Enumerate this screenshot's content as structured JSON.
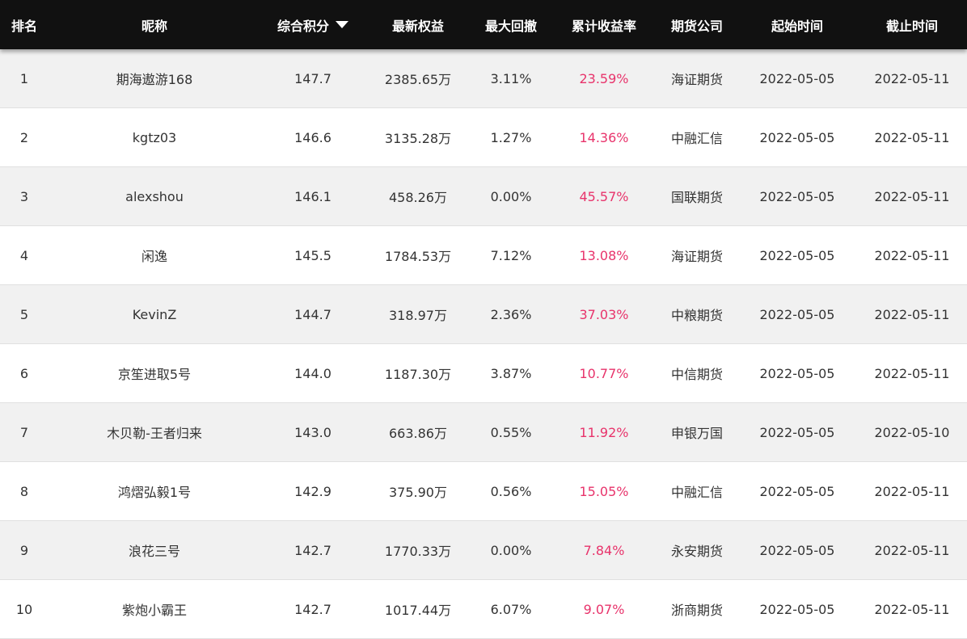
{
  "header": {
    "rank": "排名",
    "name": "昵称",
    "score": "综合积分",
    "equity": "最新权益",
    "drawdown": "最大回撤",
    "return": "累计收益率",
    "company": "期货公司",
    "start": "起始时间",
    "end": "截止时间",
    "sort_icon": "caret-down-icon"
  },
  "colors": {
    "header_bg": "#111111",
    "odd_row_bg": "#f1f1f1",
    "return_text": "#e8336b"
  },
  "rows": [
    {
      "rank": "1",
      "name": "期海遨游168",
      "score": "147.7",
      "equity": "2385.65万",
      "drawdown": "3.11%",
      "return": "23.59%",
      "company": "海证期货",
      "start": "2022-05-05",
      "end": "2022-05-11"
    },
    {
      "rank": "2",
      "name": "kgtz03",
      "score": "146.6",
      "equity": "3135.28万",
      "drawdown": "1.27%",
      "return": "14.36%",
      "company": "中融汇信",
      "start": "2022-05-05",
      "end": "2022-05-11"
    },
    {
      "rank": "3",
      "name": "alexshou",
      "score": "146.1",
      "equity": "458.26万",
      "drawdown": "0.00%",
      "return": "45.57%",
      "company": "国联期货",
      "start": "2022-05-05",
      "end": "2022-05-11"
    },
    {
      "rank": "4",
      "name": "闲逸",
      "score": "145.5",
      "equity": "1784.53万",
      "drawdown": "7.12%",
      "return": "13.08%",
      "company": "海证期货",
      "start": "2022-05-05",
      "end": "2022-05-11"
    },
    {
      "rank": "5",
      "name": "KevinZ",
      "score": "144.7",
      "equity": "318.97万",
      "drawdown": "2.36%",
      "return": "37.03%",
      "company": "中粮期货",
      "start": "2022-05-05",
      "end": "2022-05-11"
    },
    {
      "rank": "6",
      "name": "京笙进取5号",
      "score": "144.0",
      "equity": "1187.30万",
      "drawdown": "3.87%",
      "return": "10.77%",
      "company": "中信期货",
      "start": "2022-05-05",
      "end": "2022-05-11"
    },
    {
      "rank": "7",
      "name": "木贝勒-王者归来",
      "score": "143.0",
      "equity": "663.86万",
      "drawdown": "0.55%",
      "return": "11.92%",
      "company": "申银万国",
      "start": "2022-05-05",
      "end": "2022-05-10"
    },
    {
      "rank": "8",
      "name": "鸿熠弘毅1号",
      "score": "142.9",
      "equity": "375.90万",
      "drawdown": "0.56%",
      "return": "15.05%",
      "company": "中融汇信",
      "start": "2022-05-05",
      "end": "2022-05-11"
    },
    {
      "rank": "9",
      "name": "浪花三号",
      "score": "142.7",
      "equity": "1770.33万",
      "drawdown": "0.00%",
      "return": "7.84%",
      "company": "永安期货",
      "start": "2022-05-05",
      "end": "2022-05-11"
    },
    {
      "rank": "10",
      "name": "紫炮小霸王",
      "score": "142.7",
      "equity": "1017.44万",
      "drawdown": "6.07%",
      "return": "9.07%",
      "company": "浙商期货",
      "start": "2022-05-05",
      "end": "2022-05-11"
    }
  ]
}
